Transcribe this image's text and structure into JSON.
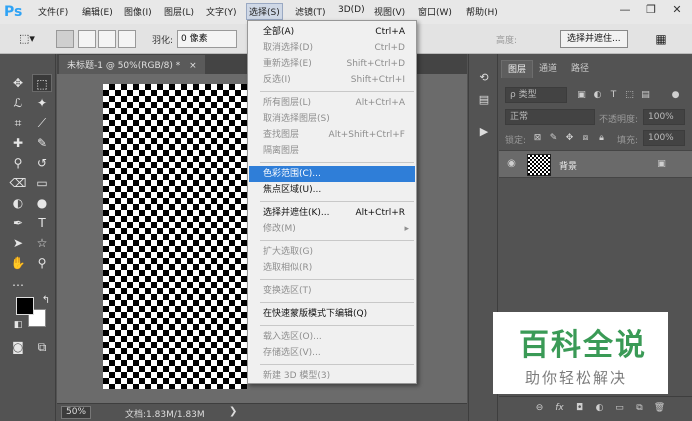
{
  "app": {
    "logo": "Ps"
  },
  "menubar": {
    "items": [
      "文件(F)",
      "编辑(E)",
      "图像(I)",
      "图层(L)",
      "文字(Y)",
      "选择(S)",
      "滤镜(T)",
      "3D(D)",
      "视图(V)",
      "窗口(W)",
      "帮助(H)"
    ],
    "active": "选择(S)",
    "window_controls": [
      "minimize-icon",
      "restore-icon",
      "close-icon"
    ]
  },
  "options": {
    "feather_label": "羽化:",
    "feather_value": "0 像素",
    "height_label": "高度:",
    "select_mask_button": "选择并遮住..."
  },
  "document": {
    "tab_title": "未标题-1 @ 50%(RGB/8) *",
    "tab_close": "×",
    "zoom": "50%",
    "doc_info": "文档:1.83M/1.83M",
    "status_arrow": "❯"
  },
  "select_menu": {
    "groups": [
      [
        {
          "label": "全部(A)",
          "shortcut": "Ctrl+A",
          "enabled": true
        },
        {
          "label": "取消选择(D)",
          "shortcut": "Ctrl+D",
          "enabled": false
        },
        {
          "label": "重新选择(E)",
          "shortcut": "Shift+Ctrl+D",
          "enabled": false
        },
        {
          "label": "反选(I)",
          "shortcut": "Shift+Ctrl+I",
          "enabled": false
        }
      ],
      [
        {
          "label": "所有图层(L)",
          "shortcut": "Alt+Ctrl+A",
          "enabled": false
        },
        {
          "label": "取消选择图层(S)",
          "shortcut": "",
          "enabled": false
        },
        {
          "label": "查找图层",
          "shortcut": "Alt+Shift+Ctrl+F",
          "enabled": false
        },
        {
          "label": "隔离图层",
          "shortcut": "",
          "enabled": false
        }
      ],
      [
        {
          "label": "色彩范围(C)...",
          "shortcut": "",
          "enabled": true,
          "highlighted": true
        },
        {
          "label": "焦点区域(U)...",
          "shortcut": "",
          "enabled": true
        }
      ],
      [
        {
          "label": "选择并遮住(K)...",
          "shortcut": "Alt+Ctrl+R",
          "enabled": true
        },
        {
          "label": "修改(M)",
          "shortcut": "",
          "enabled": false,
          "submenu": true
        }
      ],
      [
        {
          "label": "扩大选取(G)",
          "shortcut": "",
          "enabled": false
        },
        {
          "label": "选取相似(R)",
          "shortcut": "",
          "enabled": false
        }
      ],
      [
        {
          "label": "变换选区(T)",
          "shortcut": "",
          "enabled": false
        }
      ],
      [
        {
          "label": "在快速蒙版模式下编辑(Q)",
          "shortcut": "",
          "enabled": true
        }
      ],
      [
        {
          "label": "载入选区(O)...",
          "shortcut": "",
          "enabled": false
        },
        {
          "label": "存储选区(V)...",
          "shortcut": "",
          "enabled": false
        }
      ],
      [
        {
          "label": "新建 3D 模型(3)",
          "shortcut": "",
          "enabled": false
        }
      ]
    ],
    "submenu_arrow": "▸"
  },
  "layers_panel": {
    "tabs": [
      "图层",
      "通道",
      "路径"
    ],
    "active_tab": "图层",
    "filter_kind": "ρ 类型",
    "blend_mode": "正常",
    "opacity_label": "不透明度:",
    "opacity_value": "100%",
    "lock_label": "锁定:",
    "fill_label": "填充:",
    "fill_value": "100%",
    "layer_name": "背景"
  },
  "watermark": {
    "title": "百科全说",
    "subtitle": "助你轻松解决"
  },
  "colors": {
    "foreground": "#000000",
    "background": "#ffffff",
    "highlight": "#2f7ed8",
    "ps_blue": "#2fa3f5",
    "watermark_green": "#3a9a56"
  }
}
